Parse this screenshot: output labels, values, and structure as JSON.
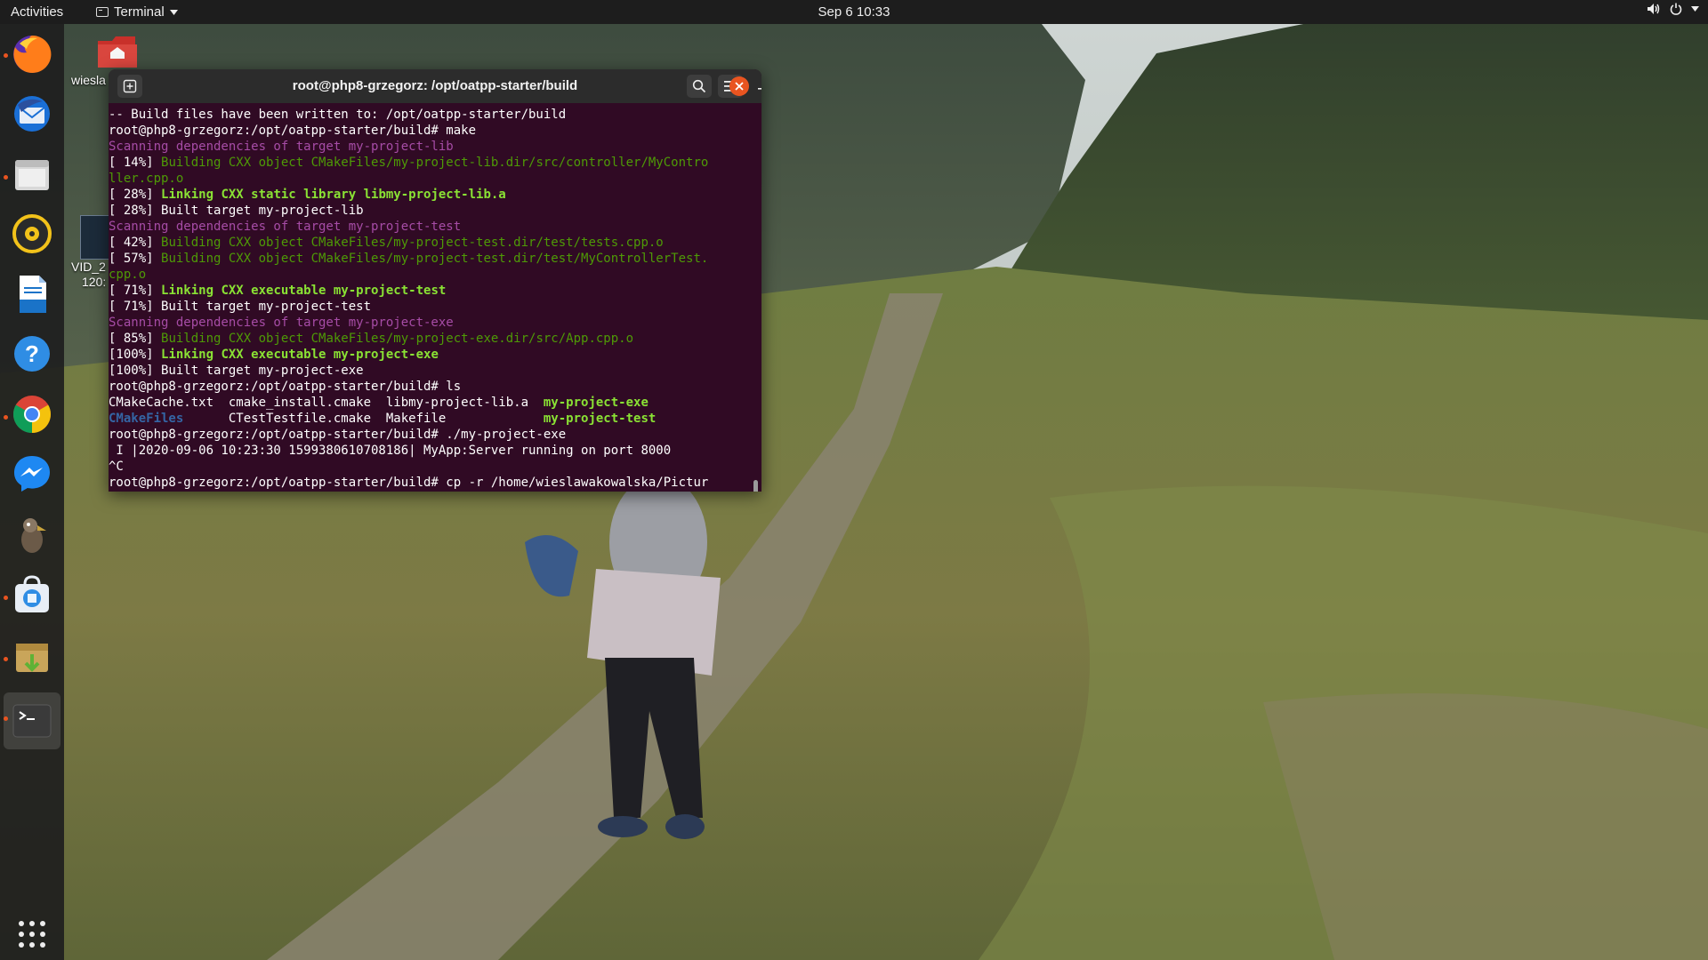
{
  "topbar": {
    "activities": "Activities",
    "app_name": "Terminal",
    "clock": "Sep 6  10:33"
  },
  "desktop": {
    "icon_label_1": "wiesla",
    "icon_label_2": "VID_2",
    "icon_label_3": "120:"
  },
  "dock": {
    "items": [
      "firefox-icon",
      "thunderbird-icon",
      "files-icon",
      "rhythmbox-icon",
      "libreoffice-writer-icon",
      "help-icon",
      "chrome-icon",
      "messenger-icon",
      "gimp-icon",
      "software-icon",
      "archive-manager-icon",
      "terminal-icon"
    ],
    "show_apps": "show-applications-icon"
  },
  "terminal": {
    "title": "root@php8-grzegorz: /opt/oatpp-starter/build",
    "lines": [
      {
        "segs": [
          {
            "t": "-- Build files have been written to: /opt/oatpp-starter/build",
            "c": "c-white"
          }
        ]
      },
      {
        "segs": [
          {
            "t": "root@php8-grzegorz:/opt/oatpp-starter/build# make",
            "c": "c-white"
          }
        ]
      },
      {
        "segs": [
          {
            "t": "Scanning dependencies of target my-project-lib",
            "c": "c-purple"
          }
        ]
      },
      {
        "segs": [
          {
            "t": "[ 14%] ",
            "c": "c-white"
          },
          {
            "t": "Building CXX object CMakeFiles/my-project-lib.dir/src/controller/MyContro",
            "c": "c-green"
          }
        ]
      },
      {
        "segs": [
          {
            "t": "ller.cpp.o",
            "c": "c-green"
          }
        ]
      },
      {
        "segs": [
          {
            "t": "[ 28%] ",
            "c": "c-white"
          },
          {
            "t": "Linking CXX static library libmy-project-lib.a",
            "c": "c-greenb"
          }
        ]
      },
      {
        "segs": [
          {
            "t": "[ 28%] Built target my-project-lib",
            "c": "c-white"
          }
        ]
      },
      {
        "segs": [
          {
            "t": "Scanning dependencies of target my-project-test",
            "c": "c-purple"
          }
        ]
      },
      {
        "segs": [
          {
            "t": "[ 42%] ",
            "c": "c-white"
          },
          {
            "t": "Building CXX object CMakeFiles/my-project-test.dir/test/tests.cpp.o",
            "c": "c-green"
          }
        ]
      },
      {
        "segs": [
          {
            "t": "[ 57%] ",
            "c": "c-white"
          },
          {
            "t": "Building CXX object CMakeFiles/my-project-test.dir/test/MyControllerTest.",
            "c": "c-green"
          }
        ]
      },
      {
        "segs": [
          {
            "t": "cpp.o",
            "c": "c-green"
          }
        ]
      },
      {
        "segs": [
          {
            "t": "[ 71%] ",
            "c": "c-white"
          },
          {
            "t": "Linking CXX executable my-project-test",
            "c": "c-greenb"
          }
        ]
      },
      {
        "segs": [
          {
            "t": "[ 71%] Built target my-project-test",
            "c": "c-white"
          }
        ]
      },
      {
        "segs": [
          {
            "t": "Scanning dependencies of target my-project-exe",
            "c": "c-purple"
          }
        ]
      },
      {
        "segs": [
          {
            "t": "[ 85%] ",
            "c": "c-white"
          },
          {
            "t": "Building CXX object CMakeFiles/my-project-exe.dir/src/App.cpp.o",
            "c": "c-green"
          }
        ]
      },
      {
        "segs": [
          {
            "t": "[100%] ",
            "c": "c-white"
          },
          {
            "t": "Linking CXX executable my-project-exe",
            "c": "c-greenb"
          }
        ]
      },
      {
        "segs": [
          {
            "t": "[100%] Built target my-project-exe",
            "c": "c-white"
          }
        ]
      },
      {
        "segs": [
          {
            "t": "root@php8-grzegorz:/opt/oatpp-starter/build# ls",
            "c": "c-white"
          }
        ]
      },
      {
        "segs": [
          {
            "t": "CMakeCache.txt  cmake_install.cmake  libmy-project-lib.a  ",
            "c": "c-white"
          },
          {
            "t": "my-project-exe",
            "c": "c-greenb"
          }
        ]
      },
      {
        "segs": [
          {
            "t": "CMakeFiles",
            "c": "c-blue"
          },
          {
            "t": "      CTestTestfile.cmake  Makefile             ",
            "c": "c-white"
          },
          {
            "t": "my-project-test",
            "c": "c-greenb"
          }
        ]
      },
      {
        "segs": [
          {
            "t": "root@php8-grzegorz:/opt/oatpp-starter/build# ./my-project-exe",
            "c": "c-white"
          }
        ]
      },
      {
        "segs": [
          {
            "t": " I |2020-09-06 10:23:30 1599380610708186| MyApp:Server running on port 8000",
            "c": "c-white"
          }
        ]
      },
      {
        "segs": [
          {
            "t": "^C",
            "c": "c-white"
          }
        ]
      },
      {
        "segs": [
          {
            "t": "root@php8-grzegorz:/opt/oatpp-starter/build# cp -r /home/wieslawakowalska/Pictur",
            "c": "c-white"
          }
        ]
      }
    ]
  },
  "colors": {
    "terminal_bg": "#300a24",
    "header_bg": "#2c2c2c",
    "close_button": "#e95420",
    "topbar_bg": "#1d1d1d",
    "dock_bg": "#1e1e1e"
  }
}
